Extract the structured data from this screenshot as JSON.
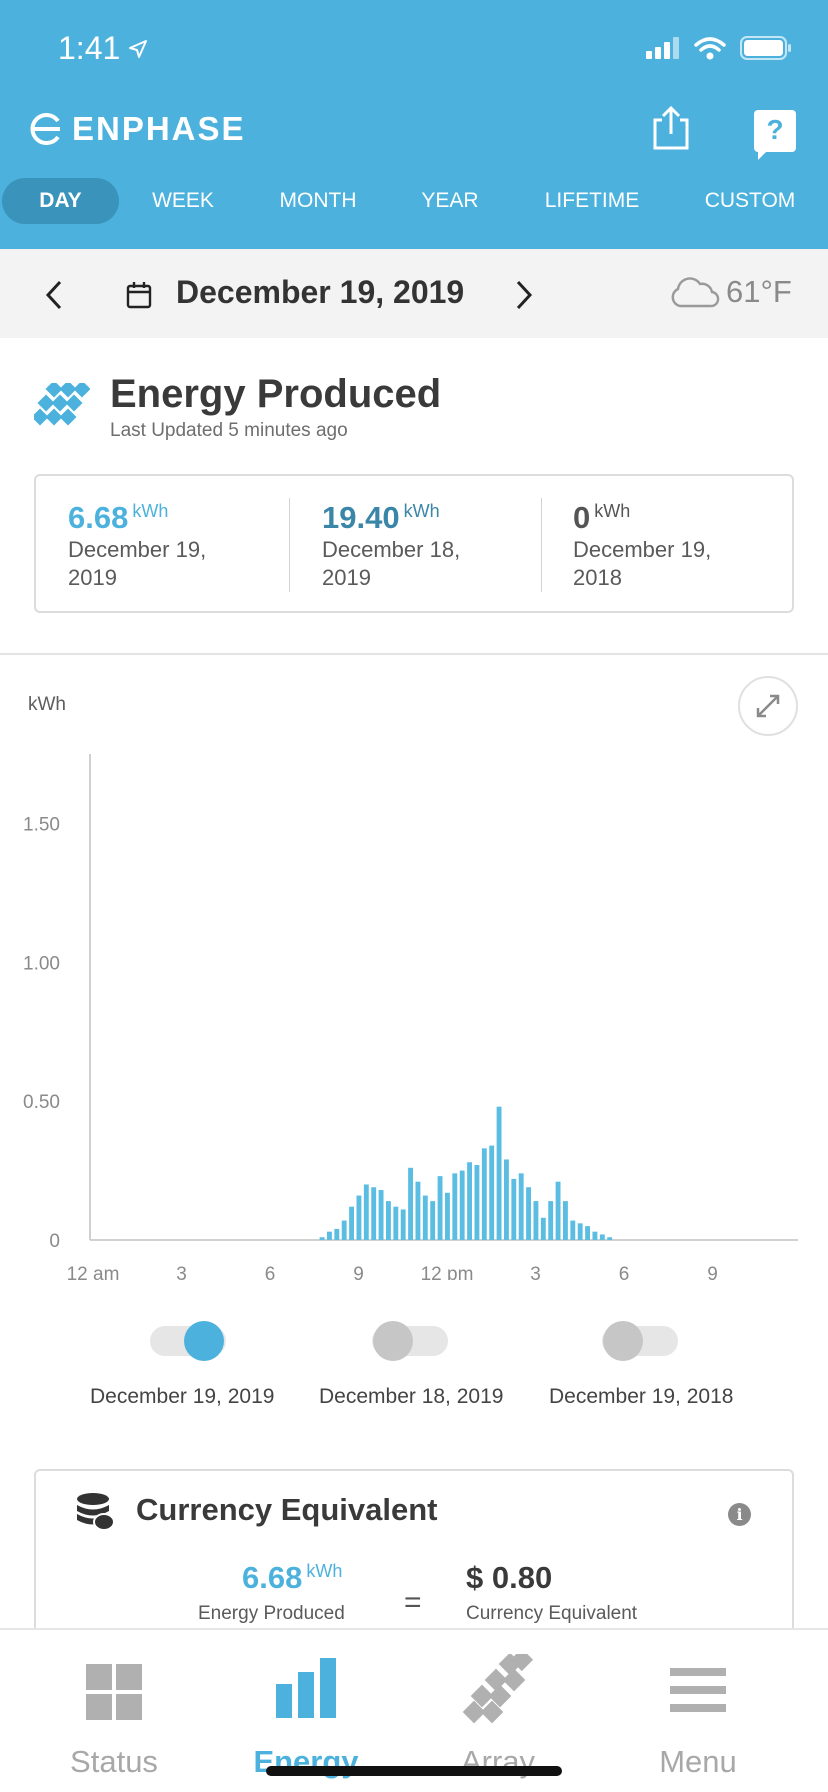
{
  "status_bar": {
    "time": "1:41"
  },
  "header": {
    "brand": "ENPHASE",
    "tabs": [
      "DAY",
      "WEEK",
      "MONTH",
      "YEAR",
      "LIFETIME",
      "CUSTOM"
    ],
    "active_tab": "DAY",
    "help_label": "?"
  },
  "date_bar": {
    "date": "December 19, 2019",
    "temperature": "61°F",
    "weather_icon": "cloud-icon"
  },
  "energy": {
    "title": "Energy Produced",
    "subtitle": "Last Updated 5 minutes ago",
    "summary": [
      {
        "value": "6.68",
        "unit": "kWh",
        "date_line1": "December 19,",
        "date_line2": "2019",
        "color": "#4cb2dd"
      },
      {
        "value": "19.40",
        "unit": "kWh",
        "date_line1": "December 18,",
        "date_line2": "2019",
        "color": "#3a86a8"
      },
      {
        "value": "0",
        "unit": "kWh",
        "date_line1": "December 19,",
        "date_line2": "2018",
        "color": "#555555"
      }
    ]
  },
  "chart_data": {
    "type": "bar",
    "ylabel": "kWh",
    "ylim": [
      0,
      1.75
    ],
    "yticks": [
      "0",
      "0.50",
      "1.00",
      "1.50"
    ],
    "xticks": [
      "12 am",
      "3",
      "6",
      "9",
      "12 pm",
      "3",
      "6",
      "9"
    ],
    "interval_minutes": 15,
    "first_bar_hour": 7.75,
    "values": [
      0.01,
      0.03,
      0.04,
      0.07,
      0.12,
      0.16,
      0.2,
      0.19,
      0.18,
      0.14,
      0.12,
      0.11,
      0.26,
      0.21,
      0.16,
      0.14,
      0.23,
      0.17,
      0.24,
      0.25,
      0.28,
      0.27,
      0.33,
      0.34,
      0.48,
      0.29,
      0.22,
      0.24,
      0.19,
      0.14,
      0.08,
      0.14,
      0.21,
      0.14,
      0.07,
      0.06,
      0.05,
      0.03,
      0.02,
      0.01
    ],
    "series_color": "#5bbde2",
    "legend": [
      {
        "name": "December 19, 2019",
        "on": true
      },
      {
        "name": "December 18, 2019",
        "on": false
      },
      {
        "name": "December 19, 2018",
        "on": false
      }
    ]
  },
  "currency": {
    "title": "Currency Equivalent",
    "energy_value": "6.68",
    "energy_unit": "kWh",
    "energy_label": "Energy Produced",
    "equals": "=",
    "currency_value": "$ 0.80",
    "currency_label": "Currency Equivalent"
  },
  "bottom_nav": [
    {
      "label": "Status",
      "icon": "status-grid-icon"
    },
    {
      "label": "Energy",
      "icon": "energy-bars-icon",
      "active": true
    },
    {
      "label": "Array",
      "icon": "array-panels-icon"
    },
    {
      "label": "Menu",
      "icon": "menu-lines-icon"
    }
  ]
}
